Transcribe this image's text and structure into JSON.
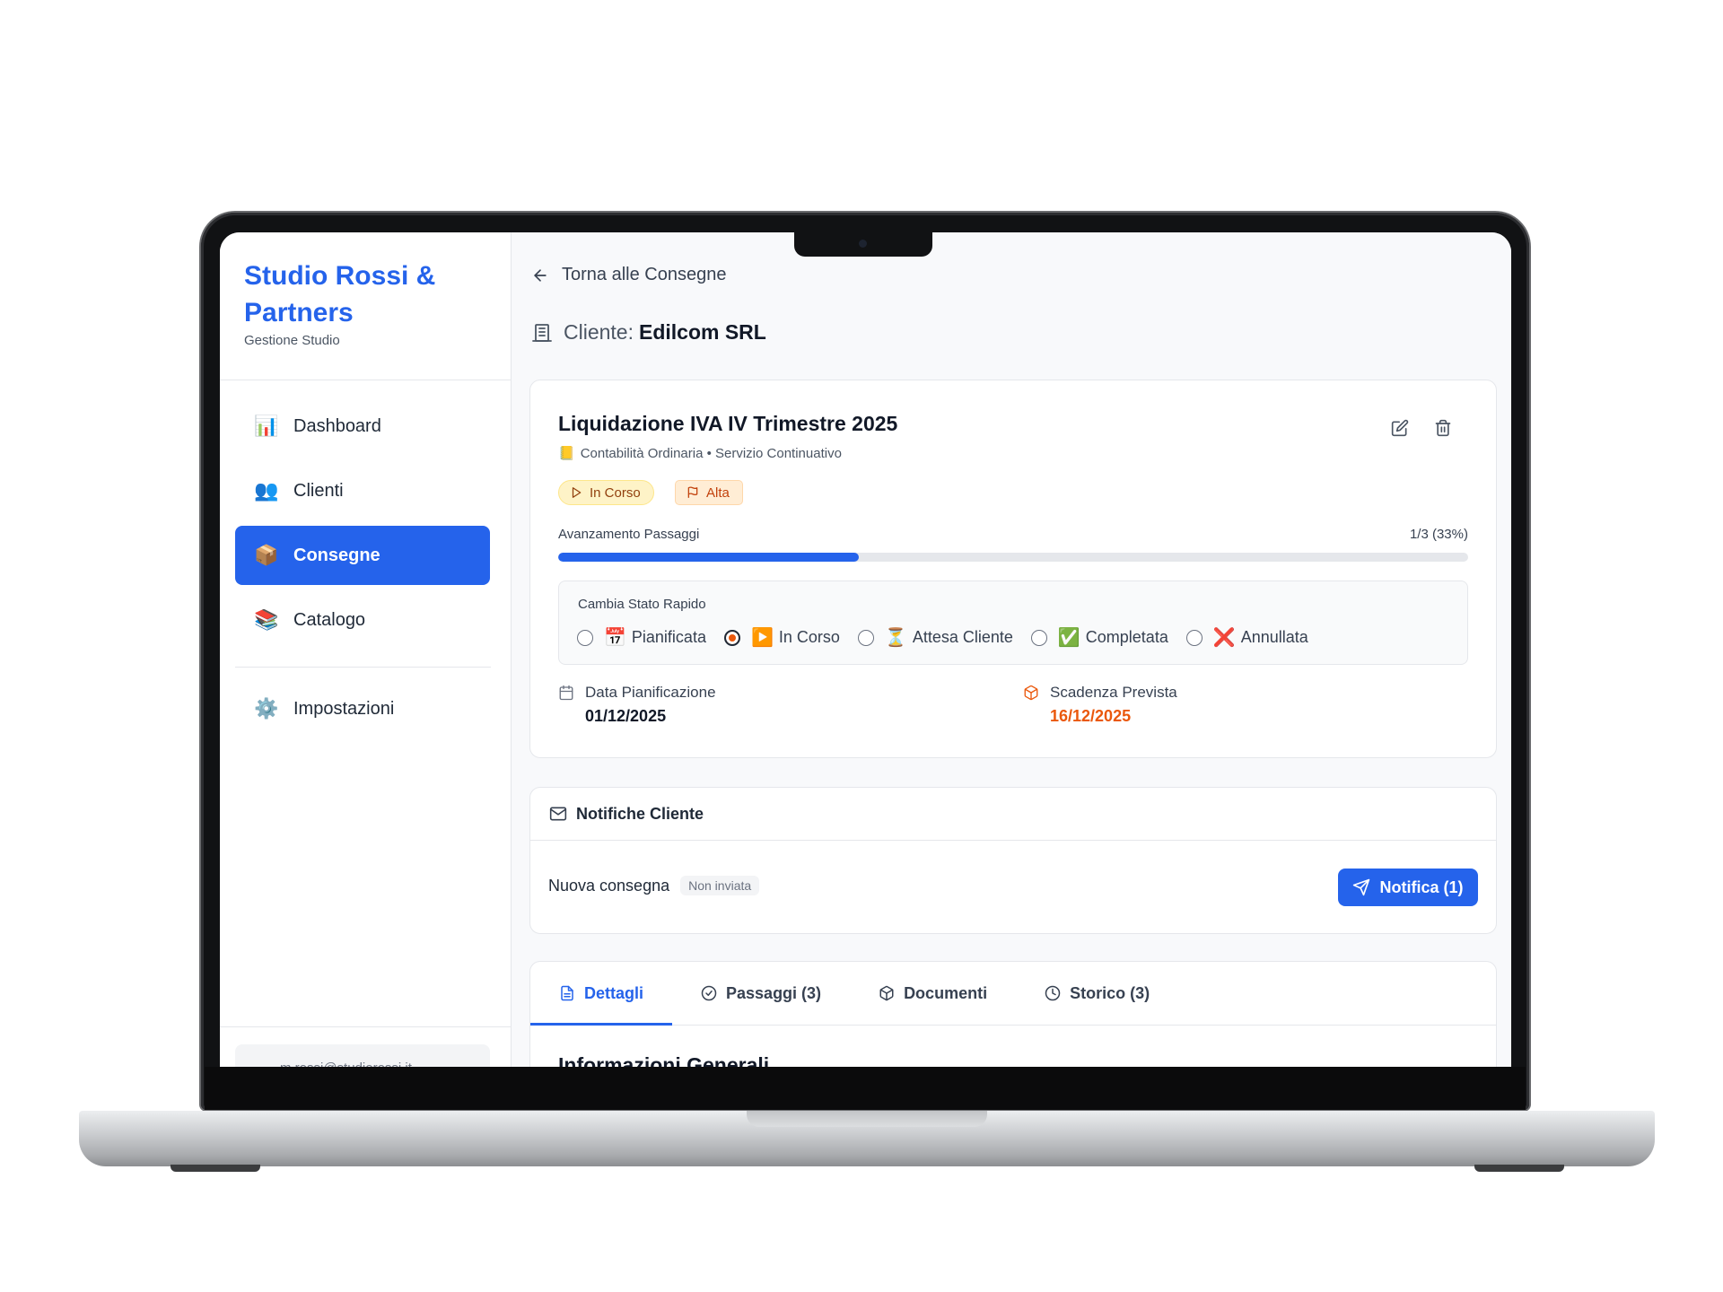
{
  "sidebar": {
    "brand_title": "Studio Rossi & Partners",
    "brand_subtitle": "Gestione Studio",
    "items": [
      {
        "label": "Dashboard",
        "icon": "📊"
      },
      {
        "label": "Clienti",
        "icon": "👥"
      },
      {
        "label": "Consegne",
        "icon": "📦",
        "active": true
      },
      {
        "label": "Catalogo",
        "icon": "📚"
      }
    ],
    "settings": {
      "label": "Impostazioni",
      "icon": "⚙️"
    },
    "user_email": "m.rossi@studiorossi.it"
  },
  "header": {
    "back_label": "Torna alle Consegne",
    "client_prefix": "Cliente:",
    "client_name": "Edilcom SRL"
  },
  "task": {
    "title": "Liquidazione IVA IV Trimestre 2025",
    "subtitle": "Contabilità Ordinaria • Servizio Continuativo",
    "status_badge": "In Corso",
    "priority_badge": "Alta",
    "progress_label": "Avanzamento Passaggi",
    "progress_count": "1/3 (33%)",
    "progress_fraction": 0.33,
    "quick_status": {
      "title": "Cambia Stato Rapido",
      "options": [
        {
          "label": "Pianificata",
          "emoji": "📅",
          "selected": false
        },
        {
          "label": "In Corso",
          "emoji": "▶️",
          "selected": true
        },
        {
          "label": "Attesa Cliente",
          "emoji": "⏳",
          "selected": false
        },
        {
          "label": "Completata",
          "emoji": "✅",
          "selected": false
        },
        {
          "label": "Annullata",
          "emoji": "❌",
          "selected": false
        }
      ]
    },
    "planned": {
      "label": "Data Pianificazione",
      "value": "01/12/2025"
    },
    "due": {
      "label": "Scadenza Prevista",
      "value": "16/12/2025"
    }
  },
  "notifications": {
    "title": "Notifiche Cliente",
    "item_label": "Nuova consegna",
    "item_status": "Non inviata",
    "button_label": "Notifica (1)"
  },
  "tabs": [
    {
      "label": "Dettagli",
      "icon": "document-icon",
      "active": true
    },
    {
      "label": "Passaggi (3)",
      "icon": "check-circle-icon"
    },
    {
      "label": "Documenti",
      "icon": "package-icon"
    },
    {
      "label": "Storico (3)",
      "icon": "clock-icon"
    }
  ],
  "details_section_title": "Informazioni Generali",
  "colors": {
    "accent": "#2563eb",
    "warning": "#ea580c",
    "status_bg": "#fef3c7"
  }
}
